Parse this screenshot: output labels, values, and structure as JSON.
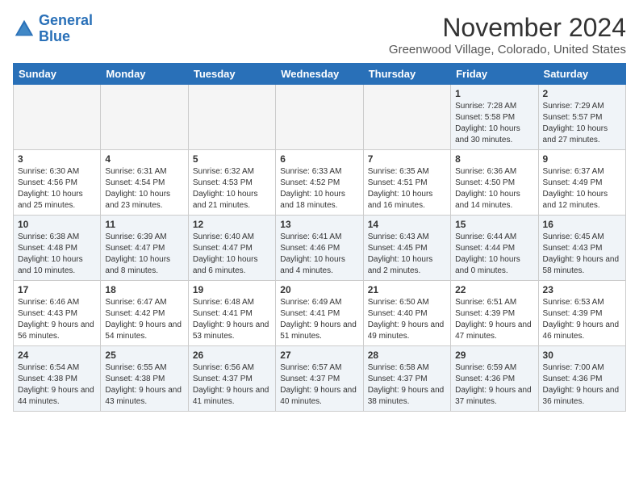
{
  "logo": {
    "line1": "General",
    "line2": "Blue"
  },
  "title": "November 2024",
  "location": "Greenwood Village, Colorado, United States",
  "weekdays": [
    "Sunday",
    "Monday",
    "Tuesday",
    "Wednesday",
    "Thursday",
    "Friday",
    "Saturday"
  ],
  "weeks": [
    [
      {
        "day": "",
        "info": ""
      },
      {
        "day": "",
        "info": ""
      },
      {
        "day": "",
        "info": ""
      },
      {
        "day": "",
        "info": ""
      },
      {
        "day": "",
        "info": ""
      },
      {
        "day": "1",
        "info": "Sunrise: 7:28 AM\nSunset: 5:58 PM\nDaylight: 10 hours and 30 minutes."
      },
      {
        "day": "2",
        "info": "Sunrise: 7:29 AM\nSunset: 5:57 PM\nDaylight: 10 hours and 27 minutes."
      }
    ],
    [
      {
        "day": "3",
        "info": "Sunrise: 6:30 AM\nSunset: 4:56 PM\nDaylight: 10 hours and 25 minutes."
      },
      {
        "day": "4",
        "info": "Sunrise: 6:31 AM\nSunset: 4:54 PM\nDaylight: 10 hours and 23 minutes."
      },
      {
        "day": "5",
        "info": "Sunrise: 6:32 AM\nSunset: 4:53 PM\nDaylight: 10 hours and 21 minutes."
      },
      {
        "day": "6",
        "info": "Sunrise: 6:33 AM\nSunset: 4:52 PM\nDaylight: 10 hours and 18 minutes."
      },
      {
        "day": "7",
        "info": "Sunrise: 6:35 AM\nSunset: 4:51 PM\nDaylight: 10 hours and 16 minutes."
      },
      {
        "day": "8",
        "info": "Sunrise: 6:36 AM\nSunset: 4:50 PM\nDaylight: 10 hours and 14 minutes."
      },
      {
        "day": "9",
        "info": "Sunrise: 6:37 AM\nSunset: 4:49 PM\nDaylight: 10 hours and 12 minutes."
      }
    ],
    [
      {
        "day": "10",
        "info": "Sunrise: 6:38 AM\nSunset: 4:48 PM\nDaylight: 10 hours and 10 minutes."
      },
      {
        "day": "11",
        "info": "Sunrise: 6:39 AM\nSunset: 4:47 PM\nDaylight: 10 hours and 8 minutes."
      },
      {
        "day": "12",
        "info": "Sunrise: 6:40 AM\nSunset: 4:47 PM\nDaylight: 10 hours and 6 minutes."
      },
      {
        "day": "13",
        "info": "Sunrise: 6:41 AM\nSunset: 4:46 PM\nDaylight: 10 hours and 4 minutes."
      },
      {
        "day": "14",
        "info": "Sunrise: 6:43 AM\nSunset: 4:45 PM\nDaylight: 10 hours and 2 minutes."
      },
      {
        "day": "15",
        "info": "Sunrise: 6:44 AM\nSunset: 4:44 PM\nDaylight: 10 hours and 0 minutes."
      },
      {
        "day": "16",
        "info": "Sunrise: 6:45 AM\nSunset: 4:43 PM\nDaylight: 9 hours and 58 minutes."
      }
    ],
    [
      {
        "day": "17",
        "info": "Sunrise: 6:46 AM\nSunset: 4:43 PM\nDaylight: 9 hours and 56 minutes."
      },
      {
        "day": "18",
        "info": "Sunrise: 6:47 AM\nSunset: 4:42 PM\nDaylight: 9 hours and 54 minutes."
      },
      {
        "day": "19",
        "info": "Sunrise: 6:48 AM\nSunset: 4:41 PM\nDaylight: 9 hours and 53 minutes."
      },
      {
        "day": "20",
        "info": "Sunrise: 6:49 AM\nSunset: 4:41 PM\nDaylight: 9 hours and 51 minutes."
      },
      {
        "day": "21",
        "info": "Sunrise: 6:50 AM\nSunset: 4:40 PM\nDaylight: 9 hours and 49 minutes."
      },
      {
        "day": "22",
        "info": "Sunrise: 6:51 AM\nSunset: 4:39 PM\nDaylight: 9 hours and 47 minutes."
      },
      {
        "day": "23",
        "info": "Sunrise: 6:53 AM\nSunset: 4:39 PM\nDaylight: 9 hours and 46 minutes."
      }
    ],
    [
      {
        "day": "24",
        "info": "Sunrise: 6:54 AM\nSunset: 4:38 PM\nDaylight: 9 hours and 44 minutes."
      },
      {
        "day": "25",
        "info": "Sunrise: 6:55 AM\nSunset: 4:38 PM\nDaylight: 9 hours and 43 minutes."
      },
      {
        "day": "26",
        "info": "Sunrise: 6:56 AM\nSunset: 4:37 PM\nDaylight: 9 hours and 41 minutes."
      },
      {
        "day": "27",
        "info": "Sunrise: 6:57 AM\nSunset: 4:37 PM\nDaylight: 9 hours and 40 minutes."
      },
      {
        "day": "28",
        "info": "Sunrise: 6:58 AM\nSunset: 4:37 PM\nDaylight: 9 hours and 38 minutes."
      },
      {
        "day": "29",
        "info": "Sunrise: 6:59 AM\nSunset: 4:36 PM\nDaylight: 9 hours and 37 minutes."
      },
      {
        "day": "30",
        "info": "Sunrise: 7:00 AM\nSunset: 4:36 PM\nDaylight: 9 hours and 36 minutes."
      }
    ]
  ]
}
